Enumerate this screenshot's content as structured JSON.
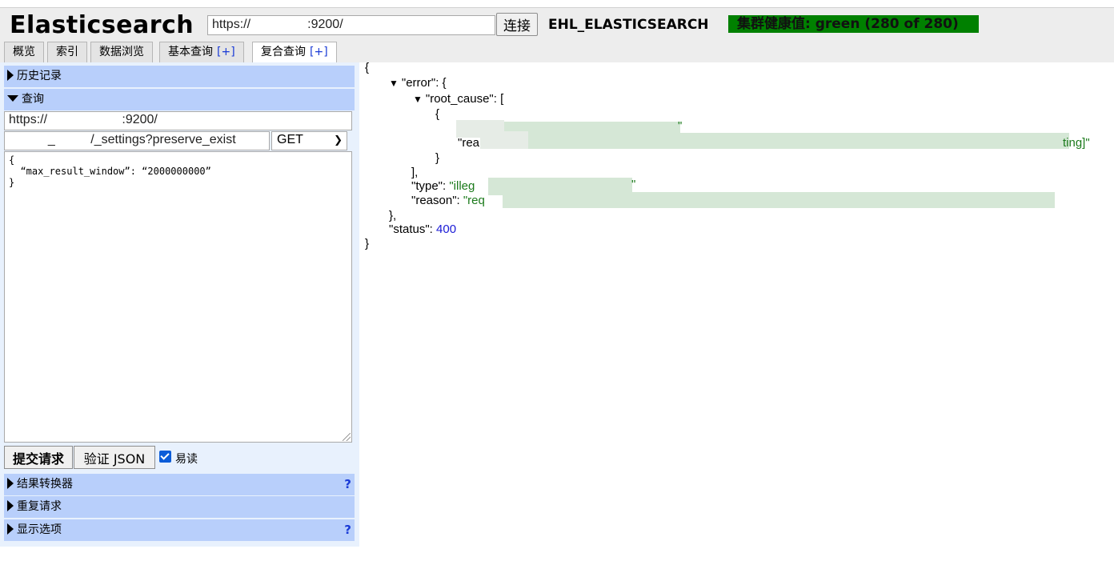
{
  "header": {
    "app_title": "Elasticsearch",
    "url": "https://                :9200/",
    "connect_label": "连接",
    "cluster_name": "EHL_ELASTICSEARCH",
    "health_text": "集群健康值: green (280 of 280)",
    "health_color": "#008000"
  },
  "tabs": [
    {
      "label": "概览"
    },
    {
      "label": "索引"
    },
    {
      "label": "数据浏览"
    },
    {
      "label": "基本查询",
      "plus": "[+]"
    },
    {
      "label": "复合查询",
      "plus": "[+]"
    }
  ],
  "sidebar": {
    "history_label": "历史记录",
    "query_label": "查询",
    "query_url": "https://                     :9200/",
    "query_path": "           _          /_settings?preserve_exist",
    "method": "GET",
    "body": "{\n  “max_result_window”: “2000000000”\n}",
    "submit_label": "提交请求",
    "validate_label": "验证 JSON",
    "pretty_label": "易读",
    "pretty_checked": true,
    "result_transformer_label": "结果转换器",
    "repeat_request_label": "重复请求",
    "display_options_label": "显示选项",
    "help_glyph": "?"
  },
  "result": {
    "open_brace": "{",
    "error_key": "\"error\": {",
    "root_cause_key": "\"root_cause\": [",
    "obj_open": "{",
    "line_partial_1": "\"",
    "reason_prefix": "\"rea",
    "reason_suffix": "ting]\"",
    "obj_close": "}",
    "arr_close": "],",
    "type_key": "\"type\":",
    "type_val": "\"illeg",
    "type_tail": "\"",
    "reason_key": "\"reason\":",
    "reason_val": "\"req",
    "error_close": "},",
    "status_key": "\"status\":",
    "status_val": "400",
    "close_brace": "}",
    "toggle_glyph": "▼"
  }
}
